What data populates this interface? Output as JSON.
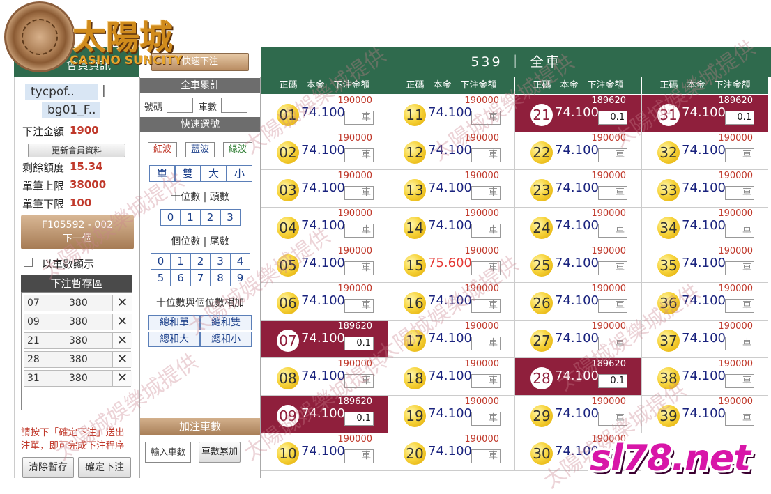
{
  "branding": {
    "logo_title": "太陽城",
    "logo_sub": "CASINO SUNCITY"
  },
  "left_panel": {
    "header": "會員資訊",
    "user_line1": "tycpof..",
    "user_line2": "bg01_F..",
    "bet_total_label": "下注金額",
    "bet_total_value": "1900",
    "update_button": "更新會員資料",
    "remaining_label": "剩餘額度",
    "remaining_value": "15.34",
    "max_label": "單筆上限",
    "max_value": "38000",
    "min_label": "單筆下限",
    "min_value": "100",
    "next_line1": "F105592 - 002",
    "next_line2": "下一個",
    "show_by_car_label": "以車數顯示",
    "temp_header": "下注暫存區",
    "temp_rows": [
      {
        "num": "07",
        "amount": "380"
      },
      {
        "num": "09",
        "amount": "380"
      },
      {
        "num": "21",
        "amount": "380"
      },
      {
        "num": "28",
        "amount": "380"
      },
      {
        "num": "31",
        "amount": "380"
      }
    ],
    "hint": "請按下「確定下注」送出注單，即可完成下注程序",
    "clear_button": "清除暫存",
    "confirm_button": "確定下注"
  },
  "mid_panel": {
    "quick_bet_button": "快速下注",
    "total_header": "全車累計",
    "num_label": "號碼",
    "car_label": "車數",
    "quick_select_header": "快速選號",
    "waves": [
      "紅波",
      "藍波",
      "綠波"
    ],
    "waves_colors": [
      "#c0392b",
      "#1b3f8a",
      "#2e7d32"
    ],
    "attrs": [
      "單",
      "雙",
      "大",
      "小"
    ],
    "tens_label": "十位數 | 頭數",
    "tens": [
      "0",
      "1",
      "2",
      "3"
    ],
    "units_label": "個位數 | 尾數",
    "units": [
      "0",
      "1",
      "2",
      "3",
      "4",
      "5",
      "6",
      "7",
      "8",
      "9"
    ],
    "sum_label": "十位數與個位數相加",
    "sums": [
      "總和單",
      "總和雙",
      "總和大",
      "總和小"
    ],
    "add_header": "加注車數",
    "add_input_placeholder": "輸入車數",
    "add_button": "車數累加"
  },
  "grid": {
    "title": "539 ｜ 全車",
    "col_header": "正碼　本金　下注金額",
    "car_placeholder": "車",
    "cells": [
      {
        "num": "01",
        "odds": "74.100",
        "limit": "190000",
        "amount": "",
        "selected": false,
        "red": false
      },
      {
        "num": "02",
        "odds": "74.100",
        "limit": "190000",
        "amount": "",
        "selected": false,
        "red": false
      },
      {
        "num": "03",
        "odds": "74.100",
        "limit": "190000",
        "amount": "",
        "selected": false,
        "red": false
      },
      {
        "num": "04",
        "odds": "74.100",
        "limit": "190000",
        "amount": "",
        "selected": false,
        "red": false
      },
      {
        "num": "05",
        "odds": "74.100",
        "limit": "190000",
        "amount": "",
        "selected": false,
        "red": false
      },
      {
        "num": "06",
        "odds": "74.100",
        "limit": "190000",
        "amount": "",
        "selected": false,
        "red": false
      },
      {
        "num": "07",
        "odds": "74.100",
        "limit": "189620",
        "amount": "0.1",
        "selected": true,
        "red": false
      },
      {
        "num": "08",
        "odds": "74.100",
        "limit": "190000",
        "amount": "",
        "selected": false,
        "red": false
      },
      {
        "num": "09",
        "odds": "74.100",
        "limit": "189620",
        "amount": "0.1",
        "selected": true,
        "red": false
      },
      {
        "num": "10",
        "odds": "74.100",
        "limit": "190000",
        "amount": "",
        "selected": false,
        "red": false
      },
      {
        "num": "11",
        "odds": "74.100",
        "limit": "190000",
        "amount": "",
        "selected": false,
        "red": false
      },
      {
        "num": "12",
        "odds": "74.100",
        "limit": "190000",
        "amount": "",
        "selected": false,
        "red": false
      },
      {
        "num": "13",
        "odds": "74.100",
        "limit": "190000",
        "amount": "",
        "selected": false,
        "red": false
      },
      {
        "num": "14",
        "odds": "74.100",
        "limit": "190000",
        "amount": "",
        "selected": false,
        "red": false
      },
      {
        "num": "15",
        "odds": "75.600",
        "limit": "190000",
        "amount": "",
        "selected": false,
        "red": true
      },
      {
        "num": "16",
        "odds": "74.100",
        "limit": "190000",
        "amount": "",
        "selected": false,
        "red": false
      },
      {
        "num": "17",
        "odds": "74.100",
        "limit": "190000",
        "amount": "",
        "selected": false,
        "red": false
      },
      {
        "num": "18",
        "odds": "74.100",
        "limit": "190000",
        "amount": "",
        "selected": false,
        "red": false
      },
      {
        "num": "19",
        "odds": "74.100",
        "limit": "190000",
        "amount": "",
        "selected": false,
        "red": false
      },
      {
        "num": "20",
        "odds": "74.100",
        "limit": "190000",
        "amount": "",
        "selected": false,
        "red": false
      },
      {
        "num": "21",
        "odds": "74.100",
        "limit": "189620",
        "amount": "0.1",
        "selected": true,
        "red": false
      },
      {
        "num": "22",
        "odds": "74.100",
        "limit": "190000",
        "amount": "",
        "selected": false,
        "red": false
      },
      {
        "num": "23",
        "odds": "74.100",
        "limit": "190000",
        "amount": "",
        "selected": false,
        "red": false
      },
      {
        "num": "24",
        "odds": "74.100",
        "limit": "190000",
        "amount": "",
        "selected": false,
        "red": false
      },
      {
        "num": "25",
        "odds": "74.100",
        "limit": "190000",
        "amount": "",
        "selected": false,
        "red": false
      },
      {
        "num": "26",
        "odds": "74.100",
        "limit": "190000",
        "amount": "",
        "selected": false,
        "red": false
      },
      {
        "num": "27",
        "odds": "74.100",
        "limit": "190000",
        "amount": "",
        "selected": false,
        "red": false
      },
      {
        "num": "28",
        "odds": "74.100",
        "limit": "189620",
        "amount": "0.1",
        "selected": true,
        "red": false
      },
      {
        "num": "29",
        "odds": "74.100",
        "limit": "190000",
        "amount": "",
        "selected": false,
        "red": false
      },
      {
        "num": "30",
        "odds": "74.100",
        "limit": "190000",
        "amount": "",
        "selected": false,
        "red": false
      },
      {
        "num": "31",
        "odds": "74.100",
        "limit": "189620",
        "amount": "0.1",
        "selected": true,
        "red": false
      },
      {
        "num": "32",
        "odds": "74.100",
        "limit": "190000",
        "amount": "",
        "selected": false,
        "red": false
      },
      {
        "num": "33",
        "odds": "74.100",
        "limit": "190000",
        "amount": "",
        "selected": false,
        "red": false
      },
      {
        "num": "34",
        "odds": "74.100",
        "limit": "190000",
        "amount": "",
        "selected": false,
        "red": false
      },
      {
        "num": "35",
        "odds": "74.100",
        "limit": "190000",
        "amount": "",
        "selected": false,
        "red": false
      },
      {
        "num": "36",
        "odds": "74.100",
        "limit": "190000",
        "amount": "",
        "selected": false,
        "red": false
      },
      {
        "num": "37",
        "odds": "74.100",
        "limit": "190000",
        "amount": "",
        "selected": false,
        "red": false
      },
      {
        "num": "38",
        "odds": "74.100",
        "limit": "190000",
        "amount": "",
        "selected": false,
        "red": false
      },
      {
        "num": "39",
        "odds": "74.100",
        "limit": "190000",
        "amount": "",
        "selected": false,
        "red": false
      }
    ]
  },
  "watermarks": {
    "text": "太陽城娛樂城提供",
    "site": "sl78.net"
  }
}
